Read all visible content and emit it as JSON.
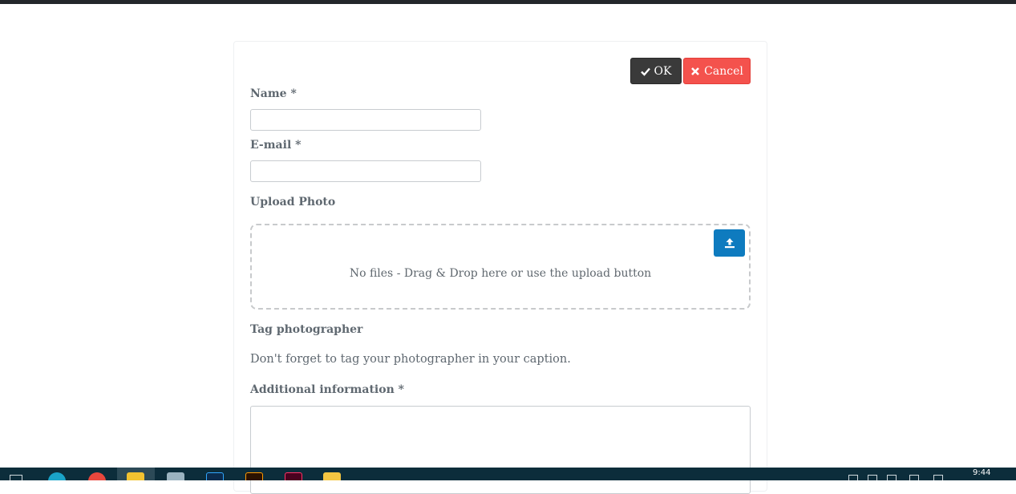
{
  "form": {
    "ok_label": "OK",
    "cancel_label": "Cancel",
    "name_label": "Name *",
    "name_value": "",
    "email_label": "E-mail *",
    "email_value": "",
    "upload_label": "Upload Photo",
    "dropzone_text": "No files - Drag & Drop here or use the upload button",
    "tag_label": "Tag photographer",
    "tag_text": "Don't forget to tag your photographer in your caption.",
    "additional_label": "Additional information *",
    "additional_value": ""
  },
  "colors": {
    "ok_button": "#3a3a3a",
    "cancel_button": "#f4524d",
    "upload_button": "#0e7bbf",
    "taskbar": "#0c2d3b"
  },
  "taskbar": {
    "time": "9:44",
    "icons": [
      "start-icon",
      "edge-icon",
      "chrome-icon",
      "paint-icon",
      "notepad-icon",
      "photoshop-icon",
      "illustrator-icon",
      "indesign-icon",
      "file-explorer-icon"
    ]
  }
}
